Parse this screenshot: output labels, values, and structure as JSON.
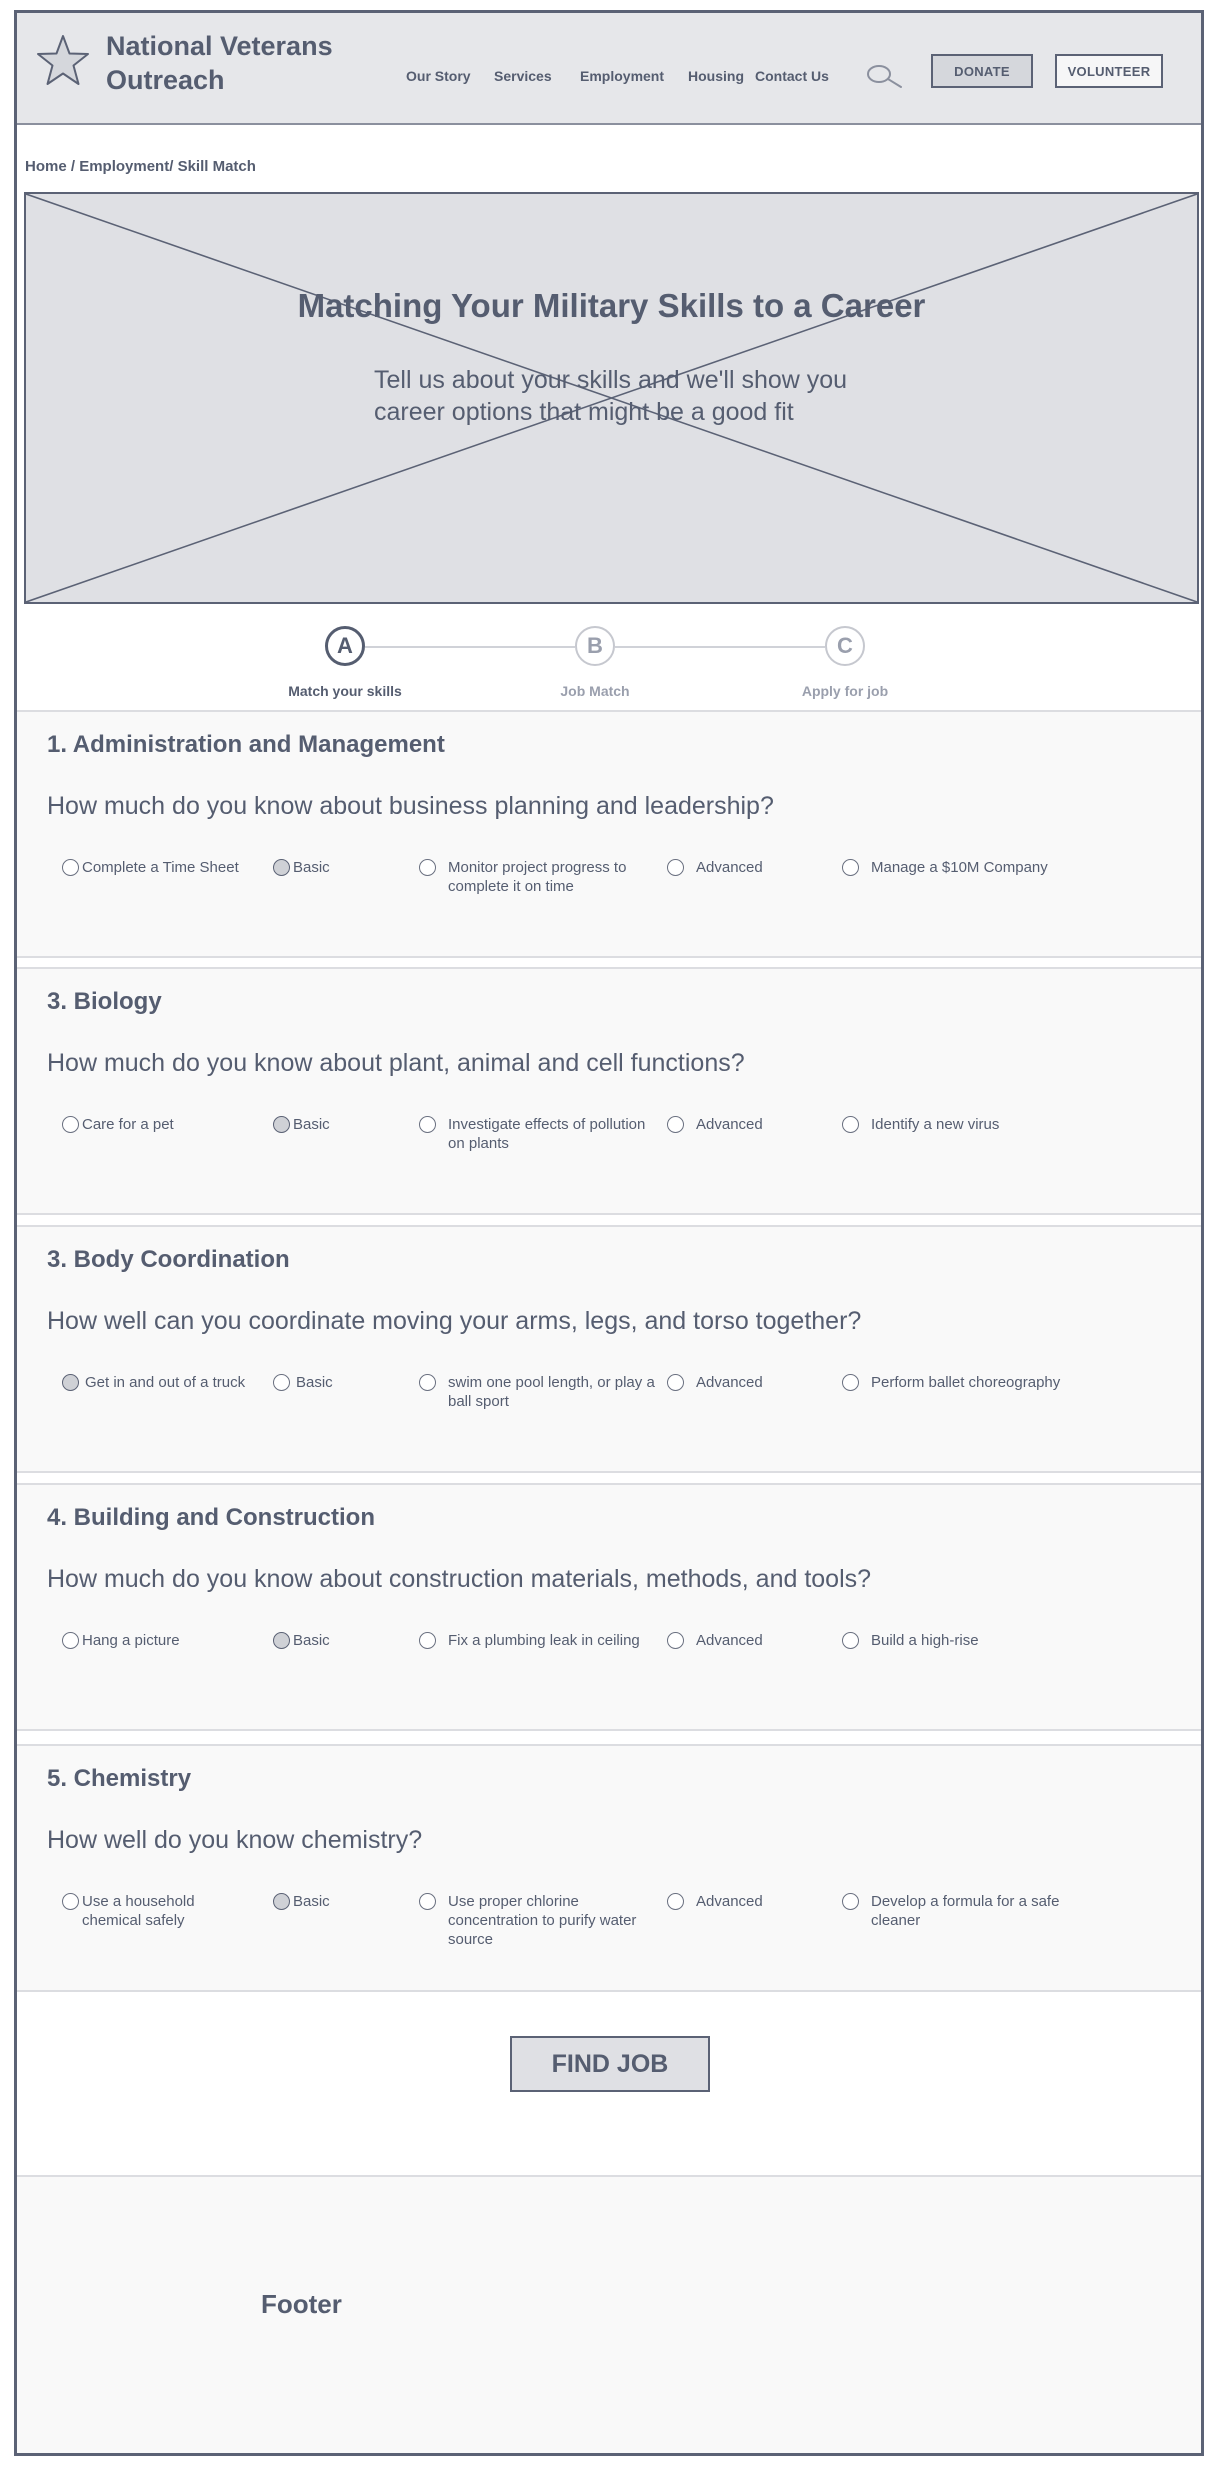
{
  "header": {
    "brand_line1": "National Veterans",
    "brand_line2": "Outreach",
    "logo_icon": "star-icon",
    "nav": [
      "Our Story",
      "Services",
      "Employment",
      "Housing",
      "Contact Us"
    ],
    "search_icon": "search-icon",
    "donate_label": "DONATE",
    "volunteer_label": "VOLUNTEER"
  },
  "breadcrumb": {
    "home": "Home",
    "employment": "Employment/",
    "current": "Skill Match"
  },
  "hero": {
    "title": "Matching Your Military Skills to a Career",
    "subtitle": "Tell us about your skills and we'll show you career options that might be a good fit"
  },
  "stepper": {
    "steps": [
      {
        "letter": "A",
        "label": "Match your skills",
        "active": true
      },
      {
        "letter": "B",
        "label": "Job Match",
        "active": false
      },
      {
        "letter": "C",
        "label": "Apply for job",
        "active": false
      }
    ]
  },
  "sections": [
    {
      "title": "1. Administration and Management",
      "question": "How much do you know about business planning and leadership?",
      "options": [
        "Complete a Time Sheet",
        "Basic",
        "Monitor project progress to complete it on time",
        "Advanced",
        "Manage a $10M Company"
      ],
      "selected": 1
    },
    {
      "title": "3. Biology",
      "question": "How much do you know about plant, animal and cell functions?",
      "options": [
        "Care for a pet",
        "Basic",
        "Investigate effects of pollution on plants",
        "Advanced",
        "Identify a new virus"
      ],
      "selected": 1
    },
    {
      "title": "3. Body Coordination",
      "question": "How well can you coordinate moving your arms, legs, and torso together?",
      "options": [
        "Get in and out of a truck",
        "Basic",
        "swim one pool length, or play a ball sport",
        "Advanced",
        "Perform ballet choreography"
      ],
      "selected": 0
    },
    {
      "title": "4. Building and Construction",
      "question": "How much do you know about construction materials, methods, and tools?",
      "options": [
        "Hang a picture",
        "Basic",
        "Fix a plumbing leak in ceiling",
        "Advanced",
        "Build a high-rise"
      ],
      "selected": 1
    },
    {
      "title": "5. Chemistry",
      "question": "How well do you know chemistry?",
      "options": [
        "Use a household chemical safely",
        "Basic",
        "Use proper chlorine concentration to purify water source",
        "Advanced",
        "Develop a formula for a safe cleaner"
      ],
      "selected": 1
    }
  ],
  "actions": {
    "find_job": "FIND JOB"
  },
  "footer": {
    "label": "Footer"
  },
  "colors": {
    "ink": "#555d70",
    "header_bg": "#e6e7ea",
    "hero_bg": "#dfe0e4",
    "section_bg": "#f9f9f9"
  }
}
